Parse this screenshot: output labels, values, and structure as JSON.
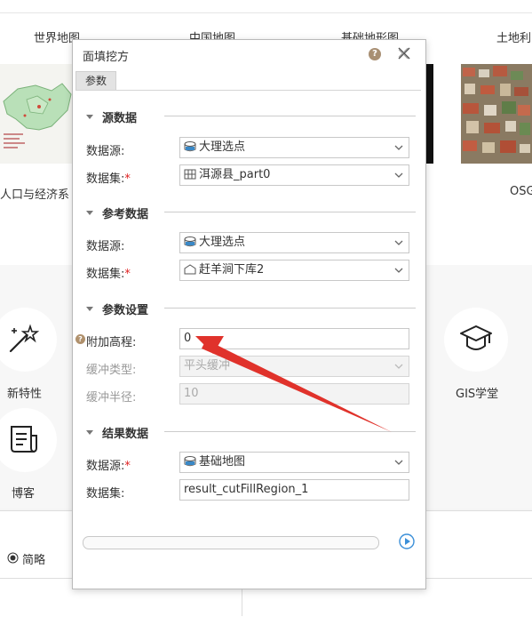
{
  "gallery": {
    "tabs": [
      "世界地图",
      "中国地图",
      "基础地形图",
      "土地利"
    ],
    "captions": [
      "人口与经济系",
      "OSG"
    ]
  },
  "features": {
    "new_features": "新特性",
    "blog": "博客",
    "gis_academy": "GIS学堂"
  },
  "bottom": {
    "radio_label": "简略"
  },
  "dialog": {
    "title": "面填挖方",
    "tab": "参数",
    "help_icon": "?",
    "sections": {
      "source": "源数据",
      "reference": "参考数据",
      "params": "参数设置",
      "result": "结果数据"
    },
    "source": {
      "datasource_label": "数据源:",
      "datasource_value": "大理选点",
      "dataset_label": "数据集:",
      "dataset_value": "洱源县_part0"
    },
    "reference": {
      "datasource_label": "数据源:",
      "datasource_value": "大理选点",
      "dataset_label": "数据集:",
      "dataset_value": "赶羊涧下库2"
    },
    "params": {
      "elevation_label": "附加高程:",
      "elevation_value": "0",
      "buffer_type_label": "缓冲类型:",
      "buffer_type_value": "平头缓冲",
      "buffer_radius_label": "缓冲半径:",
      "buffer_radius_value": "10"
    },
    "result": {
      "datasource_label": "数据源:",
      "datasource_value": "基础地图",
      "dataset_label": "数据集:",
      "dataset_value": "result_cutFillRegion_1"
    },
    "progress": 0
  },
  "colors": {
    "annotation_arrow": "#e0322b",
    "required": "#e02020",
    "run_button": "#3b8fd8"
  }
}
